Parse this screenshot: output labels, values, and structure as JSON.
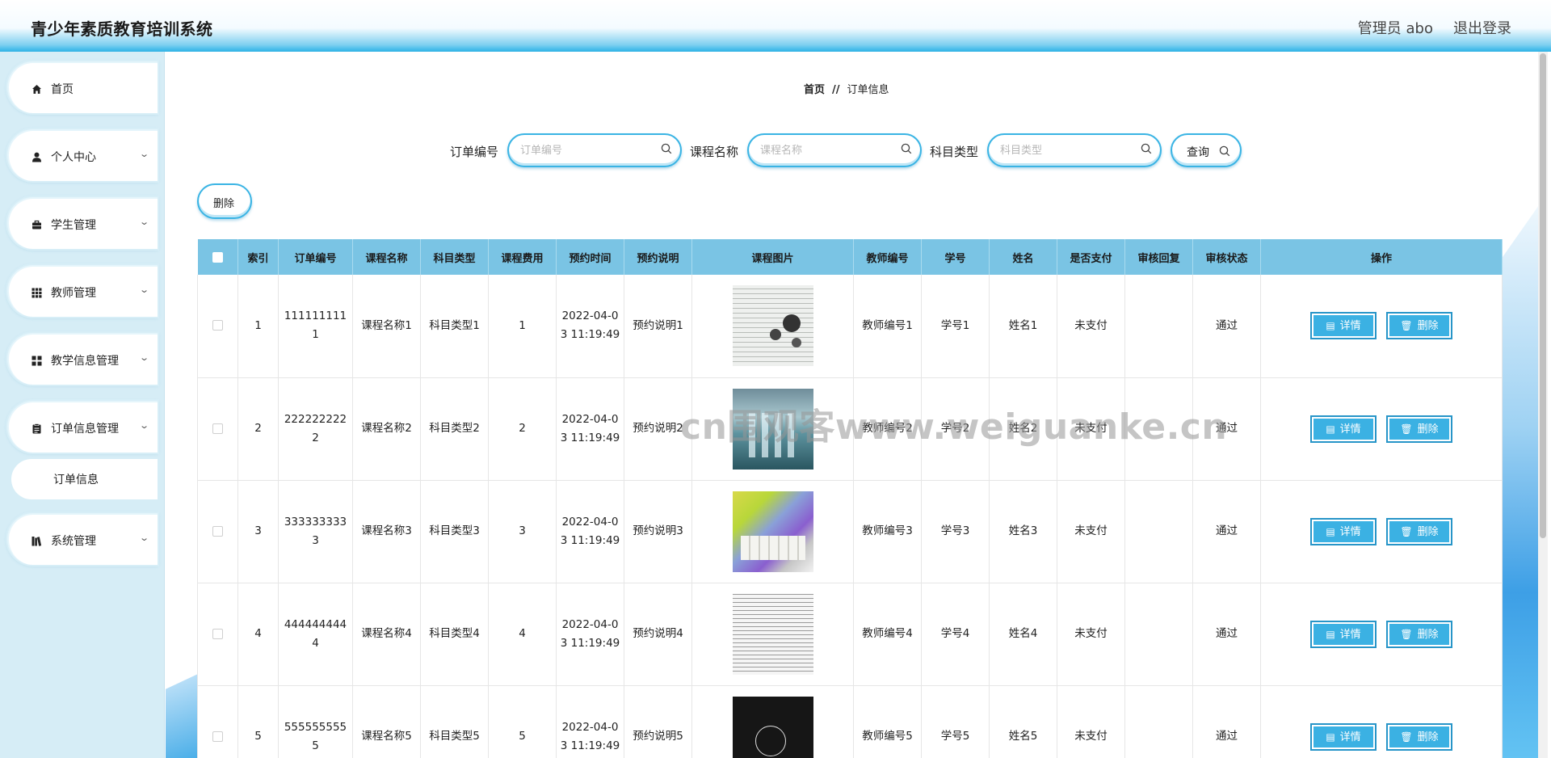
{
  "app": {
    "title": "青少年素质教育培训系统",
    "user": "管理员 abo",
    "logout": "退出登录"
  },
  "sidebar": {
    "items": [
      {
        "label": "首页",
        "icon": "home-icon",
        "arrow": ""
      },
      {
        "label": "个人中心",
        "icon": "user-icon",
        "arrow": "⌄"
      },
      {
        "label": "学生管理",
        "icon": "briefcase-icon",
        "arrow": "⌄"
      },
      {
        "label": "教师管理",
        "icon": "grid-icon",
        "arrow": "⌄"
      },
      {
        "label": "教学信息管理",
        "icon": "apps-icon",
        "arrow": "⌄"
      },
      {
        "label": "订单信息管理",
        "icon": "clipboard-icon",
        "arrow": "⌄"
      },
      {
        "label": "系统管理",
        "icon": "library-icon",
        "arrow": "⌄"
      }
    ],
    "sub_item": "订单信息"
  },
  "breadcrumb": {
    "home": "首页",
    "separator": "//",
    "current": "订单信息"
  },
  "search": {
    "fields": [
      {
        "label": "订单编号",
        "placeholder": "订单编号"
      },
      {
        "label": "课程名称",
        "placeholder": "课程名称"
      },
      {
        "label": "科目类型",
        "placeholder": "科目类型"
      }
    ],
    "query_label": "查询"
  },
  "toolbar": {
    "delete_label": "删除"
  },
  "table": {
    "columns": [
      "索引",
      "订单编号",
      "课程名称",
      "科目类型",
      "课程费用",
      "预约时间",
      "预约说明",
      "课程图片",
      "教师编号",
      "学号",
      "姓名",
      "是否支付",
      "审核回复",
      "审核状态",
      "操作"
    ],
    "rows": [
      {
        "index": "1",
        "order_no": "1111111111",
        "course": "课程名称1",
        "subject": "科目类型1",
        "fee": "1",
        "time": "2022-04-03 11:19:49",
        "note": "预约说明1",
        "teacher": "教师编号1",
        "student_no": "学号1",
        "name": "姓名1",
        "paid": "未支付",
        "reply": "",
        "status": "通过"
      },
      {
        "index": "2",
        "order_no": "2222222222",
        "course": "课程名称2",
        "subject": "科目类型2",
        "fee": "2",
        "time": "2022-04-03 11:19:49",
        "note": "预约说明2",
        "teacher": "教师编号2",
        "student_no": "学号2",
        "name": "姓名2",
        "paid": "未支付",
        "reply": "",
        "status": "通过"
      },
      {
        "index": "3",
        "order_no": "3333333333",
        "course": "课程名称3",
        "subject": "科目类型3",
        "fee": "3",
        "time": "2022-04-03 11:19:49",
        "note": "预约说明3",
        "teacher": "教师编号3",
        "student_no": "学号3",
        "name": "姓名3",
        "paid": "未支付",
        "reply": "",
        "status": "通过"
      },
      {
        "index": "4",
        "order_no": "4444444444",
        "course": "课程名称4",
        "subject": "科目类型4",
        "fee": "4",
        "time": "2022-04-03 11:19:49",
        "note": "预约说明4",
        "teacher": "教师编号4",
        "student_no": "学号4",
        "name": "姓名4",
        "paid": "未支付",
        "reply": "",
        "status": "通过"
      },
      {
        "index": "5",
        "order_no": "5555555555",
        "course": "课程名称5",
        "subject": "科目类型5",
        "fee": "5",
        "time": "2022-04-03 11:19:49",
        "note": "预约说明5",
        "teacher": "教师编号5",
        "student_no": "学号5",
        "name": "姓名5",
        "paid": "未支付",
        "reply": "",
        "status": "通过"
      }
    ],
    "detail_label": "详情",
    "delete_label": "删除"
  },
  "watermark": "cn围观客www.weiguanke.cn",
  "colors": {
    "accent": "#3bb1e3",
    "header_cell": "#7ac4e4",
    "sidebar_bg": "#d6edf6"
  }
}
